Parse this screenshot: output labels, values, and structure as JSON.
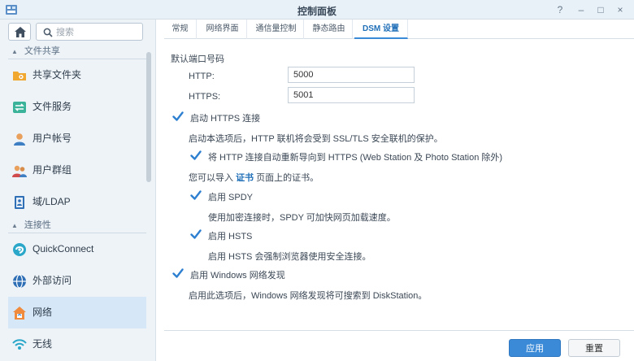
{
  "window": {
    "title": "控制面板",
    "buttons": {
      "help": "?",
      "minimize": "–",
      "maximize": "□",
      "close": "×"
    }
  },
  "sidebar": {
    "search_placeholder": "搜索",
    "sections": [
      {
        "label": "文件共享",
        "items": [
          {
            "label": "共享文件夹",
            "icon": "shared-folder-icon"
          },
          {
            "label": "文件服务",
            "icon": "file-services-icon"
          },
          {
            "label": "用户帐号",
            "icon": "user-icon"
          },
          {
            "label": "用户群组",
            "icon": "group-icon"
          },
          {
            "label": "域/LDAP",
            "icon": "domain-ldap-icon"
          }
        ]
      },
      {
        "label": "连接性",
        "items": [
          {
            "label": "QuickConnect",
            "icon": "quickconnect-icon"
          },
          {
            "label": "外部访问",
            "icon": "external-access-icon"
          },
          {
            "label": "网络",
            "icon": "network-icon",
            "active": true
          },
          {
            "label": "无线",
            "icon": "wireless-icon"
          }
        ]
      }
    ]
  },
  "tabs": [
    {
      "label": "常规"
    },
    {
      "label": "网络界面"
    },
    {
      "label": "通信量控制"
    },
    {
      "label": "静态路由"
    },
    {
      "label": "DSM 设置",
      "active": true
    }
  ],
  "dsm": {
    "default_port_label": "默认端口号码",
    "http_label": "HTTP:",
    "http_value": "5000",
    "https_label": "HTTPS:",
    "https_value": "5001",
    "enable_https_label": "启动 HTTPS 连接",
    "enable_https_desc": "启动本选项后，HTTP 联机将会受到 SSL/TLS 安全联机的保护。",
    "redirect_label": "将 HTTP 连接自动重新导向到 HTTPS (Web Station 及 Photo Station 除外)",
    "cert_prefix": "您可以导入",
    "cert_link": "证书",
    "cert_suffix": "页面上的证书。",
    "spdy_label": "启用 SPDY",
    "spdy_desc": "使用加密连接时，SPDY 可加快网页加载速度。",
    "hsts_label": "启用 HSTS",
    "hsts_desc": "启用 HSTS 会强制浏览器使用安全连接。",
    "windows_discovery_label": "启用 Windows 网络发现",
    "windows_discovery_desc": "启用此选项后，Windows 网络发现将可搜索到 DiskStation。"
  },
  "footer": {
    "apply": "应用",
    "reset": "重置"
  },
  "colors": {
    "accent": "#3b8ad8",
    "check": "#2d7fd0",
    "sidebar_active": "#d6e7f7"
  }
}
